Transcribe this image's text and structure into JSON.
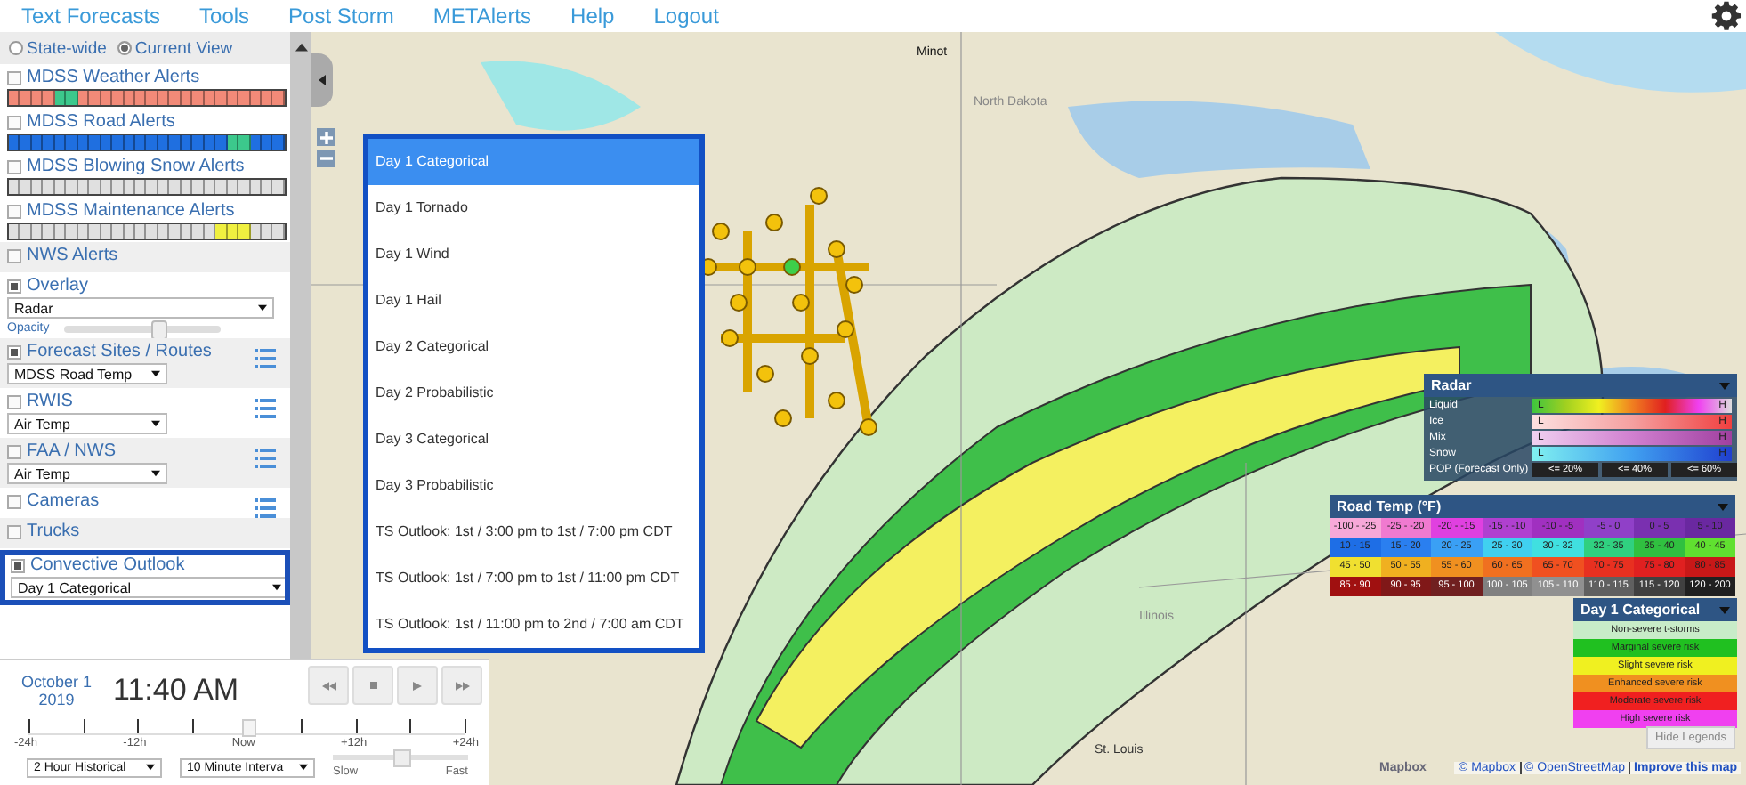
{
  "nav": [
    "Text Forecasts",
    "Tools",
    "Post Storm",
    "METAlerts",
    "Help",
    "Logout"
  ],
  "scope": [
    {
      "label": "State-wide",
      "selected": false
    },
    {
      "label": "Current View",
      "selected": true
    }
  ],
  "layers": [
    {
      "kind": "alert",
      "label": "MDSS Weather Alerts",
      "checked": false,
      "cells": [
        {
          "color": "#f28a78"
        },
        {
          "color": "#f28a78"
        },
        {
          "color": "#f28a78"
        },
        {
          "color": "#f28a78"
        },
        {
          "color": "#3cc88c"
        },
        {
          "color": "#3cc88c"
        },
        {
          "color": "#f28a78"
        },
        {
          "color": "#f28a78"
        },
        {
          "color": "#f28a78"
        },
        {
          "color": "#f28a78"
        },
        {
          "color": "#f28a78"
        },
        {
          "color": "#f28a78"
        },
        {
          "color": "#f28a78"
        },
        {
          "color": "#f28a78"
        },
        {
          "color": "#f28a78"
        },
        {
          "color": "#f28a78"
        },
        {
          "color": "#f28a78"
        },
        {
          "color": "#f28a78"
        },
        {
          "color": "#f28a78"
        },
        {
          "color": "#f28a78"
        },
        {
          "color": "#f28a78"
        },
        {
          "color": "#f28a78"
        },
        {
          "color": "#f28a78"
        },
        {
          "color": "#f28a78"
        }
      ]
    },
    {
      "kind": "alert",
      "label": "MDSS Road Alerts",
      "checked": false,
      "cells": [
        {
          "color": "#1f6fe0"
        },
        {
          "color": "#1f6fe0"
        },
        {
          "color": "#1f6fe0"
        },
        {
          "color": "#1f6fe0"
        },
        {
          "color": "#1f6fe0"
        },
        {
          "color": "#1f6fe0"
        },
        {
          "color": "#1f6fe0"
        },
        {
          "color": "#1f6fe0"
        },
        {
          "color": "#1f6fe0"
        },
        {
          "color": "#1f6fe0"
        },
        {
          "color": "#1f6fe0"
        },
        {
          "color": "#1f6fe0"
        },
        {
          "color": "#1f6fe0"
        },
        {
          "color": "#1f6fe0"
        },
        {
          "color": "#1f6fe0"
        },
        {
          "color": "#1f6fe0"
        },
        {
          "color": "#1f6fe0"
        },
        {
          "color": "#1f6fe0"
        },
        {
          "color": "#1f6fe0"
        },
        {
          "color": "#3cc88c"
        },
        {
          "color": "#3cc88c"
        },
        {
          "color": "#1f6fe0"
        },
        {
          "color": "#1f6fe0"
        },
        {
          "color": "#1f6fe0"
        }
      ]
    },
    {
      "kind": "alert",
      "label": "MDSS Blowing Snow Alerts",
      "checked": false,
      "cells": [
        {
          "color": "#e0e0e0"
        },
        {
          "color": "#e0e0e0"
        },
        {
          "color": "#e0e0e0"
        },
        {
          "color": "#e0e0e0"
        },
        {
          "color": "#e0e0e0"
        },
        {
          "color": "#e0e0e0"
        },
        {
          "color": "#e0e0e0"
        },
        {
          "color": "#e0e0e0"
        },
        {
          "color": "#e0e0e0"
        },
        {
          "color": "#e0e0e0"
        },
        {
          "color": "#e0e0e0"
        },
        {
          "color": "#e0e0e0"
        },
        {
          "color": "#e0e0e0"
        },
        {
          "color": "#e0e0e0"
        },
        {
          "color": "#e0e0e0"
        },
        {
          "color": "#e0e0e0"
        },
        {
          "color": "#e0e0e0"
        },
        {
          "color": "#e0e0e0"
        },
        {
          "color": "#e0e0e0"
        },
        {
          "color": "#e0e0e0"
        },
        {
          "color": "#e0e0e0"
        },
        {
          "color": "#e0e0e0"
        },
        {
          "color": "#e0e0e0"
        },
        {
          "color": "#e0e0e0"
        }
      ]
    },
    {
      "kind": "alert",
      "label": "MDSS Maintenance Alerts",
      "checked": false,
      "cells": [
        {
          "color": "#e0e0e0"
        },
        {
          "color": "#e0e0e0"
        },
        {
          "color": "#e0e0e0"
        },
        {
          "color": "#e0e0e0"
        },
        {
          "color": "#e0e0e0"
        },
        {
          "color": "#e0e0e0"
        },
        {
          "color": "#e0e0e0"
        },
        {
          "color": "#e0e0e0"
        },
        {
          "color": "#e0e0e0"
        },
        {
          "color": "#e0e0e0"
        },
        {
          "color": "#e0e0e0"
        },
        {
          "color": "#e0e0e0"
        },
        {
          "color": "#e0e0e0"
        },
        {
          "color": "#e0e0e0"
        },
        {
          "color": "#e0e0e0"
        },
        {
          "color": "#e0e0e0"
        },
        {
          "color": "#e0e0e0"
        },
        {
          "color": "#e0e0e0"
        },
        {
          "color": "#f0f040"
        },
        {
          "color": "#f0f040"
        },
        {
          "color": "#f0f040"
        },
        {
          "color": "#e0e0e0"
        },
        {
          "color": "#e0e0e0"
        },
        {
          "color": "#e0e0e0"
        }
      ]
    },
    {
      "kind": "plain",
      "label": "NWS Alerts",
      "checked": false
    },
    {
      "kind": "overlay",
      "label": "Overlay",
      "checked": true,
      "value": "Radar",
      "opacity_label": "Opacity",
      "level": 0.6
    },
    {
      "kind": "select",
      "label": "Forecast Sites / Routes",
      "checked": true,
      "value": "MDSS Road Temp"
    },
    {
      "kind": "select",
      "label": "RWIS",
      "checked": false,
      "value": "Air Temp"
    },
    {
      "kind": "select",
      "label": "FAA / NWS",
      "checked": false,
      "value": "Air Temp"
    },
    {
      "kind": "listed",
      "label": "Cameras",
      "checked": false
    },
    {
      "kind": "plain",
      "label": "Trucks",
      "checked": false
    },
    {
      "kind": "outlook",
      "label": "Convective Outlook",
      "checked": true,
      "value": "Day 1 Categorical"
    }
  ],
  "time": {
    "date": "October 1",
    "year": "2019",
    "clock": "11:40 AM",
    "ticks": [
      "-24h",
      "-12h",
      "Now",
      "+12h",
      "+24h"
    ],
    "level": 0.5,
    "history": "2 Hour Historical",
    "interval": "10 Minute Interva",
    "slow": "Slow",
    "fast": "Fast",
    "speed": {
      "level": 0.5
    }
  },
  "outlook_menu": [
    {
      "label": "Day 1 Categorical",
      "selected": true
    },
    {
      "label": "Day 1 Tornado",
      "selected": false
    },
    {
      "label": "Day 1 Wind",
      "selected": false
    },
    {
      "label": "Day 1 Hail",
      "selected": false
    },
    {
      "label": "Day 2 Categorical",
      "selected": false
    },
    {
      "label": "Day 2 Probabilistic",
      "selected": false
    },
    {
      "label": "Day 3 Categorical",
      "selected": false
    },
    {
      "label": "Day 3 Probabilistic",
      "selected": false
    },
    {
      "label": "TS Outlook: 1st / 3:00 pm to 1st / 7:00 pm CDT",
      "selected": false
    },
    {
      "label": "TS Outlook: 1st / 7:00 pm to 1st / 11:00 pm CDT",
      "selected": false
    },
    {
      "label": "TS Outlook: 1st / 11:00 pm to 2nd / 7:00 am CDT",
      "selected": false
    }
  ],
  "map_labels": [
    "Minot",
    "North Dakota",
    "Illinois",
    "St. Louis"
  ],
  "radar_legend": {
    "title": "Radar",
    "rows": [
      {
        "label": "Liquid",
        "low": "L",
        "high": "H"
      },
      {
        "label": "Ice",
        "low": "L",
        "high": "H"
      },
      {
        "label": "Mix",
        "low": "L",
        "high": "H"
      },
      {
        "label": "Snow",
        "low": "L",
        "high": "H"
      }
    ],
    "pop_label": "POP (Forecast Only)",
    "pop": [
      "<= 20%",
      "<= 40%",
      "<= 60%"
    ]
  },
  "road_temp_legend": {
    "title": "Road Temp (°F)",
    "cells": [
      {
        "label": "-100 - -25",
        "color": "#f7a8d8"
      },
      {
        "label": "-25 - -20",
        "color": "#f07ad0"
      },
      {
        "label": "-20 - -15",
        "color": "#e040e0"
      },
      {
        "label": "-15 - -10",
        "color": "#b040d0"
      },
      {
        "label": "-10 - -5",
        "color": "#a030c0"
      },
      {
        "label": "-5 - 0",
        "color": "#9040c8"
      },
      {
        "label": "0 - 5",
        "color": "#7a30b0"
      },
      {
        "label": "5 - 10",
        "color": "#6a28a0"
      },
      {
        "label": "10 - 15",
        "color": "#1e6ee6"
      },
      {
        "label": "15 - 20",
        "color": "#2a7ff0"
      },
      {
        "label": "20 - 25",
        "color": "#3aa0f5"
      },
      {
        "label": "25 - 30",
        "color": "#40d0f0"
      },
      {
        "label": "30 - 32",
        "color": "#40e0e0"
      },
      {
        "label": "32 - 35",
        "color": "#30d080"
      },
      {
        "label": "35 - 40",
        "color": "#30c040"
      },
      {
        "label": "40 - 45",
        "color": "#60e030"
      },
      {
        "label": "45 - 50",
        "color": "#f0e030"
      },
      {
        "label": "50 - 55",
        "color": "#f0b020"
      },
      {
        "label": "55 - 60",
        "color": "#f09020"
      },
      {
        "label": "60 - 65",
        "color": "#f07020"
      },
      {
        "label": "65 - 70",
        "color": "#f05020"
      },
      {
        "label": "70 - 75",
        "color": "#e83020"
      },
      {
        "label": "75 - 80",
        "color": "#e02020"
      },
      {
        "label": "80 - 85",
        "color": "#c81818"
      },
      {
        "label": "85 - 90",
        "color": "#a01010"
      },
      {
        "label": "90 - 95",
        "color": "#801818"
      },
      {
        "label": "95 - 100",
        "color": "#702020"
      },
      {
        "label": "100 - 105",
        "color": "#808080"
      },
      {
        "label": "105 - 110",
        "color": "#909090"
      },
      {
        "label": "110 - 115",
        "color": "#606060"
      },
      {
        "label": "115 - 120",
        "color": "#404040"
      },
      {
        "label": "120 - 200",
        "color": "#202020"
      }
    ]
  },
  "category_legend": {
    "title": "Day 1 Categorical",
    "items": [
      {
        "label": "Non-severe t-storms",
        "color": "#c8ecc8"
      },
      {
        "label": "Marginal severe risk",
        "color": "#20c020"
      },
      {
        "label": "Slight severe risk",
        "color": "#f0f020"
      },
      {
        "label": "Enhanced severe risk",
        "color": "#f09020"
      },
      {
        "label": "Moderate severe risk",
        "color": "#f02020"
      },
      {
        "label": "High severe risk",
        "color": "#f040f0"
      }
    ]
  },
  "hide_legends": "Hide Legends",
  "attribution": [
    "© Mapbox",
    "© OpenStreetMap",
    "Improve this map"
  ],
  "map_brand": "Mapbox"
}
